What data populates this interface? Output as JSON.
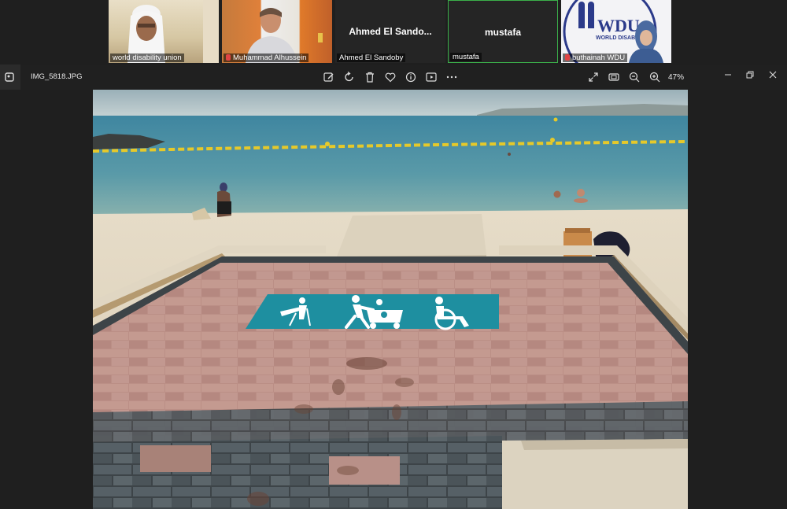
{
  "participants": [
    {
      "name": "world disability union",
      "display": "video",
      "muted": false
    },
    {
      "name": "Muhammad Alhussein",
      "display": "video",
      "muted": true
    },
    {
      "name": "Ahmed El Sandoby",
      "display": "name",
      "center_label": "Ahmed El Sando...",
      "muted": false
    },
    {
      "name": "mustafa",
      "display": "name",
      "center_label": "mustafa",
      "muted": false,
      "active_speaker": true
    },
    {
      "name": "buthainah WDU",
      "display": "video",
      "muted": true
    }
  ],
  "tile_logo_text": "WORLD DISABI",
  "viewer": {
    "filename": "IMG_5818.JPG",
    "zoom": "47%",
    "toolbar_icons": [
      "edit-icon",
      "rotate-icon",
      "delete-icon",
      "favorite-icon",
      "info-icon",
      "slideshow-icon",
      "more-icon"
    ],
    "right_icons": [
      "expand-icon",
      "fit-icon",
      "zoom-out-icon",
      "zoom-in-icon"
    ]
  },
  "photo": {
    "subject": "beach accessibility pathway with accessibility symbols",
    "accent_colors": {
      "sign": "#1e8fa0",
      "sea": "#3d8aa0",
      "sand": "#e2d7c0",
      "pavers": "#b98f85"
    }
  }
}
